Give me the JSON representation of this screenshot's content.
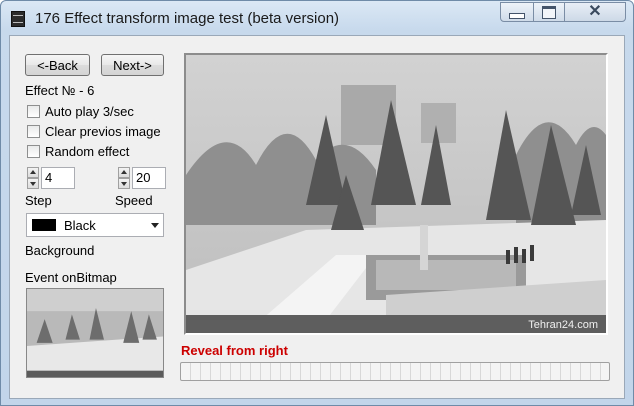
{
  "window": {
    "title": "176 Effect transform image test (beta version)"
  },
  "nav": {
    "back_label": "<-Back",
    "next_label": "Next->"
  },
  "effect": {
    "number_label": "Effect № - 6"
  },
  "options": {
    "auto_play": {
      "label": "Auto play 3/sec",
      "checked": false
    },
    "clear_previous": {
      "label": "Clear previos image",
      "checked": false
    },
    "random_effect": {
      "label": "Random effect",
      "checked": false
    }
  },
  "step": {
    "value": "4",
    "label": "Step"
  },
  "speed": {
    "value": "20",
    "label": "Speed"
  },
  "background": {
    "selected": "Black",
    "color": "#000000",
    "label": "Background"
  },
  "event": {
    "label": "Event onBitmap"
  },
  "preview": {
    "watermark": "Tehran24.com"
  },
  "status": {
    "text": "Reveal from right",
    "color": "#cc0000"
  },
  "progress": {
    "percent": 0
  },
  "icons": {
    "app": "film-icon",
    "minimize": "minimize-icon",
    "maximize": "maximize-icon",
    "close": "close-icon"
  }
}
